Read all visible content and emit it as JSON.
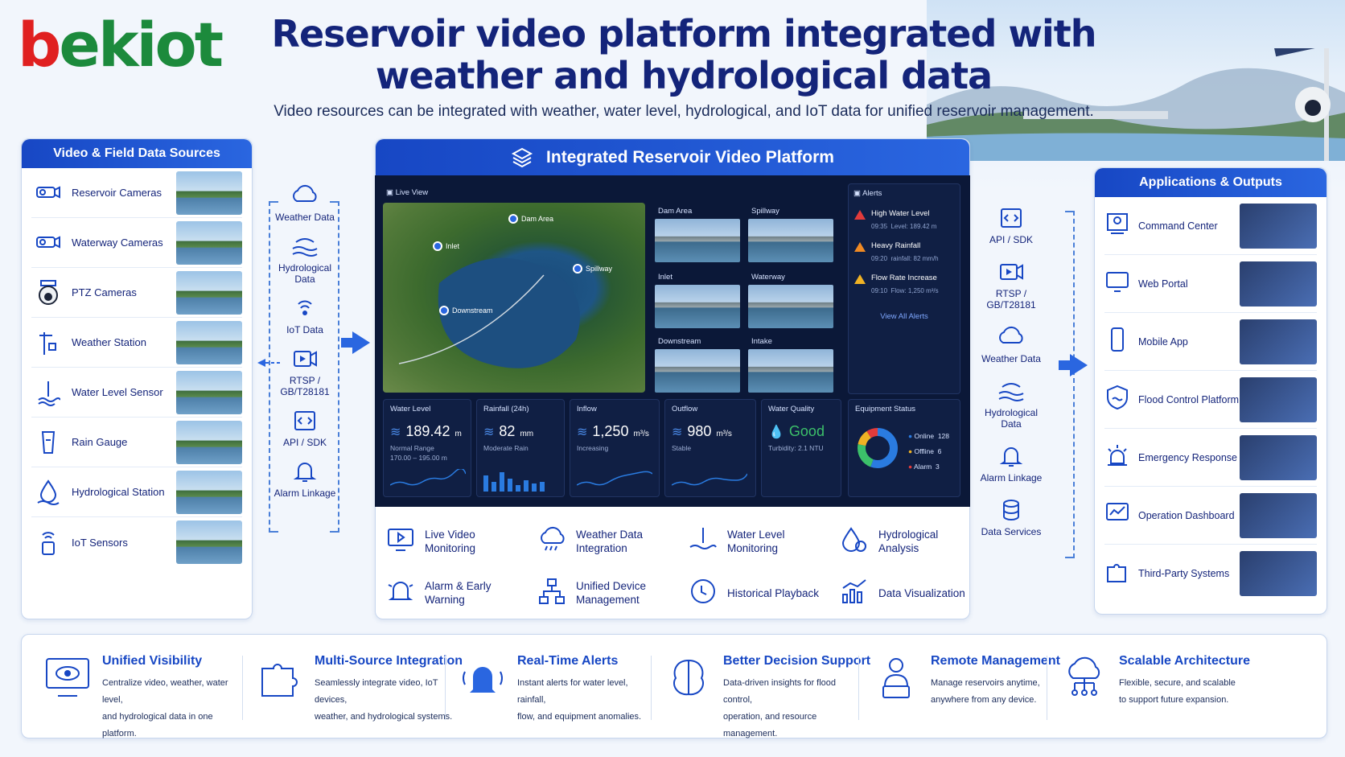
{
  "brand": {
    "logo_text": "bekiot"
  },
  "header": {
    "title_line1": "Reservoir video platform integrated with",
    "title_line2": "weather and hydrological data",
    "subtitle": "Video resources can be integrated with weather, water level, hydrological, and IoT data for unified reservoir management."
  },
  "sources": {
    "title": "Video & Field Data Sources",
    "items": [
      {
        "label": "Reservoir Cameras",
        "icon": "camera-icon"
      },
      {
        "label": "Waterway Cameras",
        "icon": "camera-icon"
      },
      {
        "label": "PTZ Cameras",
        "icon": "ptz-camera-icon"
      },
      {
        "label": "Weather Station",
        "icon": "weather-station-icon"
      },
      {
        "label": "Water Level Sensor",
        "icon": "water-level-icon"
      },
      {
        "label": "Rain Gauge",
        "icon": "rain-gauge-icon"
      },
      {
        "label": "Hydrological Station",
        "icon": "water-drop-icon"
      },
      {
        "label": "IoT Sensors",
        "icon": "iot-sensor-icon"
      }
    ]
  },
  "flow_left": [
    {
      "label": "Weather Data"
    },
    {
      "label": "Hydrological Data"
    },
    {
      "label": "IoT Data"
    },
    {
      "label": "RTSP / GB/T28181"
    },
    {
      "label": "API / SDK"
    },
    {
      "label": "Alarm Linkage"
    }
  ],
  "flow_right": [
    {
      "label": "API / SDK"
    },
    {
      "label": "RTSP / GB/T28181"
    },
    {
      "label": "Weather Data"
    },
    {
      "label": "Hydrological Data"
    },
    {
      "label": "Alarm Linkage"
    },
    {
      "label": "Data Services"
    }
  ],
  "platform": {
    "title": "Integrated Reservoir Video Platform",
    "live_view": "Live View",
    "map_pins": [
      "Dam Area",
      "Inlet",
      "Spillway",
      "Downstream"
    ],
    "cameras": [
      "Dam Area",
      "Spillway",
      "Inlet",
      "Waterway",
      "Downstream",
      "Intake"
    ],
    "alerts": {
      "title": "Alerts",
      "items": [
        {
          "title": "High Water Level",
          "time": "09:35",
          "detail": "Level: 189.42 m",
          "color": "#e23b3b"
        },
        {
          "title": "Heavy Rainfall",
          "time": "09:20",
          "detail": "rainfall: 82 mm/h",
          "color": "#f08a24"
        },
        {
          "title": "Flow Rate Increase",
          "time": "09:10",
          "detail": "Flow: 1,250 m³/s",
          "color": "#f0b224"
        }
      ],
      "view_all": "View All Alerts"
    },
    "metrics": [
      {
        "label": "Water Level",
        "value": "189.42",
        "unit": "m",
        "note1": "Normal Range",
        "note2": "170.00 – 195.00 m"
      },
      {
        "label": "Rainfall (24h)",
        "value": "82",
        "unit": "mm",
        "note1": "Moderate Rain",
        "note2": ""
      },
      {
        "label": "Inflow",
        "value": "1,250",
        "unit": "m³/s",
        "note1": "Increasing",
        "note2": ""
      },
      {
        "label": "Outflow",
        "value": "980",
        "unit": "m³/s",
        "note1": "Stable",
        "note2": ""
      },
      {
        "label": "Water Quality",
        "value": "Good",
        "unit": "",
        "note1": "Turbidity: 2.1 NTU",
        "note2": ""
      }
    ],
    "equipment": {
      "label": "Equipment Status",
      "online_label": "Online",
      "online": "128",
      "offline_label": "Offline",
      "offline": "6",
      "alarm_label": "Alarm",
      "alarm": "3",
      "colors": {
        "online": "#2a7be0",
        "offline": "#f0b224",
        "alarm": "#e23b3b",
        "extra": "#3cc06a"
      }
    },
    "features": [
      {
        "label": "Live Video Monitoring"
      },
      {
        "label": "Weather Data Integration"
      },
      {
        "label": "Water Level Monitoring"
      },
      {
        "label": "Hydrological Analysis"
      },
      {
        "label": "Alarm & Early Warning"
      },
      {
        "label": "Unified Device Management"
      },
      {
        "label": "Historical Playback"
      },
      {
        "label": "Data Visualization"
      }
    ]
  },
  "apps": {
    "title": "Applications & Outputs",
    "items": [
      {
        "label": "Command Center"
      },
      {
        "label": "Web Portal"
      },
      {
        "label": "Mobile App"
      },
      {
        "label": "Flood Control Platform"
      },
      {
        "label": "Emergency Response"
      },
      {
        "label": "Operation Dashboard"
      },
      {
        "label": "Third-Party Systems"
      }
    ]
  },
  "benefits": [
    {
      "title": "Unified Visibility",
      "line1": "Centralize video, weather, water level,",
      "line2": "and hydrological data in one platform."
    },
    {
      "title": "Multi-Source Integration",
      "line1": "Seamlessly integrate video, IoT devices,",
      "line2": "weather, and hydrological systems."
    },
    {
      "title": "Real-Time Alerts",
      "line1": "Instant alerts for water level, rainfall,",
      "line2": "flow, and equipment anomalies."
    },
    {
      "title": "Better Decision Support",
      "line1": "Data-driven insights for flood control,",
      "line2": "operation, and resource management."
    },
    {
      "title": "Remote Management",
      "line1": "Manage reservoirs anytime,",
      "line2": "anywhere from any device."
    },
    {
      "title": "Scalable Architecture",
      "line1": "Flexible, secure, and scalable",
      "line2": "to support future expansion."
    }
  ],
  "colors": {
    "primary": "#1747c4",
    "navy": "#14247a",
    "dashboard_bg": "#0b1838",
    "logo_green": "#1c8a3c",
    "logo_red": "#e02020"
  }
}
